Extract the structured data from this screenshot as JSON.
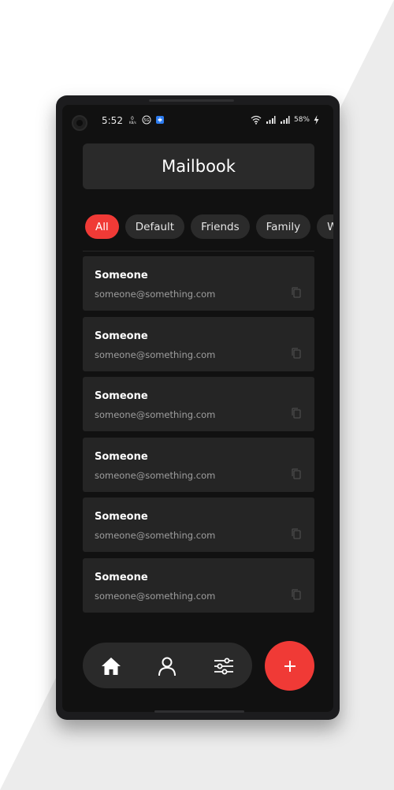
{
  "status_bar": {
    "time": "5:52",
    "battery": "58%",
    "icons_left": [
      "data-speed-icon",
      "sim-5g-icon",
      "app-notification-icon"
    ],
    "icons_right": [
      "wifi-icon",
      "signal-icon",
      "signal-icon",
      "battery-charging-icon"
    ]
  },
  "header": {
    "title": "Mailbook"
  },
  "filters": [
    {
      "label": "All",
      "active": true
    },
    {
      "label": "Default",
      "active": false
    },
    {
      "label": "Friends",
      "active": false
    },
    {
      "label": "Family",
      "active": false
    },
    {
      "label": "Work",
      "active": false
    }
  ],
  "contacts": [
    {
      "name": "Someone",
      "email": "someone@something.com"
    },
    {
      "name": "Someone",
      "email": "someone@something.com"
    },
    {
      "name": "Someone",
      "email": "someone@something.com"
    },
    {
      "name": "Someone",
      "email": "someone@something.com"
    },
    {
      "name": "Someone",
      "email": "someone@something.com"
    },
    {
      "name": "Someone",
      "email": "someone@something.com"
    }
  ],
  "bottom_nav": {
    "items": [
      "home-icon",
      "profile-icon",
      "settings-sliders-icon"
    ],
    "fab_icon": "plus-icon"
  },
  "colors": {
    "accent": "#f03a36",
    "screen_bg": "#111111",
    "card_bg": "#252525",
    "chip_bg": "#2b2b2b"
  }
}
